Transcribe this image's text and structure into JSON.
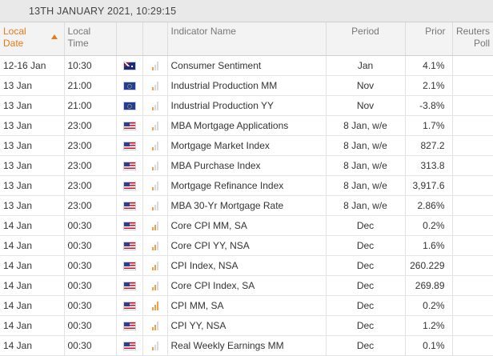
{
  "title": "13TH JANUARY 2021, 10:29:15",
  "columns": {
    "local_date": [
      "Local",
      "Date"
    ],
    "local_time": [
      "Local",
      "Time"
    ],
    "indicator": "Indicator Name",
    "period": "Period",
    "prior": "Prior",
    "poll": [
      "Reuters",
      "Poll"
    ]
  },
  "rows": [
    {
      "date": "12-16 Jan",
      "time": "10:30",
      "flag": "au",
      "importance": 1,
      "indicator": "Consumer Sentiment",
      "period": "Jan",
      "prior": "4.1%",
      "poll": ""
    },
    {
      "date": "13 Jan",
      "time": "21:00",
      "flag": "eu",
      "importance": 1,
      "indicator": "Industrial Production MM",
      "period": "Nov",
      "prior": "2.1%",
      "poll": ""
    },
    {
      "date": "13 Jan",
      "time": "21:00",
      "flag": "eu",
      "importance": 1,
      "indicator": "Industrial Production YY",
      "period": "Nov",
      "prior": "-3.8%",
      "poll": ""
    },
    {
      "date": "13 Jan",
      "time": "23:00",
      "flag": "us",
      "importance": 1,
      "indicator": "MBA Mortgage Applications",
      "period": "8 Jan, w/e",
      "prior": "1.7%",
      "poll": ""
    },
    {
      "date": "13 Jan",
      "time": "23:00",
      "flag": "us",
      "importance": 1,
      "indicator": "Mortgage Market Index",
      "period": "8 Jan, w/e",
      "prior": "827.2",
      "poll": ""
    },
    {
      "date": "13 Jan",
      "time": "23:00",
      "flag": "us",
      "importance": 1,
      "indicator": "MBA Purchase Index",
      "period": "8 Jan, w/e",
      "prior": "313.8",
      "poll": ""
    },
    {
      "date": "13 Jan",
      "time": "23:00",
      "flag": "us",
      "importance": 1,
      "indicator": "Mortgage Refinance Index",
      "period": "8 Jan, w/e",
      "prior": "3,917.6",
      "poll": ""
    },
    {
      "date": "13 Jan",
      "time": "23:00",
      "flag": "us",
      "importance": 1,
      "indicator": "MBA 30-Yr Mortgage Rate",
      "period": "8 Jan, w/e",
      "prior": "2.86%",
      "poll": ""
    },
    {
      "date": "14 Jan",
      "time": "00:30",
      "flag": "us",
      "importance": 2,
      "indicator": "Core CPI MM, SA",
      "period": "Dec",
      "prior": "0.2%",
      "poll": ""
    },
    {
      "date": "14 Jan",
      "time": "00:30",
      "flag": "us",
      "importance": 2,
      "indicator": "Core CPI YY, NSA",
      "period": "Dec",
      "prior": "1.6%",
      "poll": ""
    },
    {
      "date": "14 Jan",
      "time": "00:30",
      "flag": "us",
      "importance": 2,
      "indicator": "CPI Index, NSA",
      "period": "Dec",
      "prior": "260.229",
      "poll": ""
    },
    {
      "date": "14 Jan",
      "time": "00:30",
      "flag": "us",
      "importance": 2,
      "indicator": "Core CPI Index, SA",
      "period": "Dec",
      "prior": "269.89",
      "poll": ""
    },
    {
      "date": "14 Jan",
      "time": "00:30",
      "flag": "us",
      "importance": 3,
      "indicator": "CPI MM, SA",
      "period": "Dec",
      "prior": "0.2%",
      "poll": ""
    },
    {
      "date": "14 Jan",
      "time": "00:30",
      "flag": "us",
      "importance": 2,
      "indicator": "CPI YY, NSA",
      "period": "Dec",
      "prior": "1.2%",
      "poll": ""
    },
    {
      "date": "14 Jan",
      "time": "00:30",
      "flag": "us",
      "importance": 1,
      "indicator": "Real Weekly Earnings MM",
      "period": "Dec",
      "prior": "0.1%",
      "poll": ""
    }
  ],
  "flag_icons": {
    "au": "australia-flag-icon",
    "eu": "eu-flag-icon",
    "us": "us-flag-icon"
  },
  "colors": {
    "accent": "#e87a1a",
    "importance_on": "#f0a04b",
    "importance_off": "#d9d9d9"
  }
}
